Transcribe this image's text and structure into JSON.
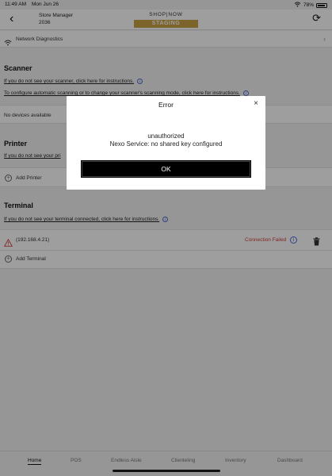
{
  "status_bar": {
    "time": "11:49 AM",
    "date": "Mon Jun 26",
    "battery": "78%"
  },
  "header": {
    "store_line1": "Store Manager",
    "store_line2": "2036",
    "logo": "SHOP|NOW",
    "env_badge": "STAGING"
  },
  "network": {
    "label": "Network Diagnostics"
  },
  "scanner": {
    "title": "Scanner",
    "link1": "If you do not see your scanner, click here for instructions.",
    "link2": "To configure automatic scanning or to change your scanner's scanning mode, click here for instructions.",
    "empty": "No devices available"
  },
  "printer": {
    "title": "Printer",
    "link1": "If you do not see your pri",
    "add": "Add Printer"
  },
  "terminal": {
    "title": "Terminal",
    "link1": "If you do not see your terminal connected, click here for instructions.",
    "device_ip": "(192.168.4.21)",
    "device_status": "Connection Failed",
    "add": "Add Terminal"
  },
  "tabs": [
    {
      "label": "Home"
    },
    {
      "label": "POS"
    },
    {
      "label": "Endless Aisle"
    },
    {
      "label": "Clienteling"
    },
    {
      "label": "Inventory"
    },
    {
      "label": "Dashboard"
    }
  ],
  "dialog": {
    "title": "Error",
    "message_line1": "unauthorized",
    "message_line2": "Nexo Service: no shared key configured",
    "ok_label": "OK"
  },
  "colors": {
    "accent": "#c9a246",
    "error": "#d23c3c",
    "info": "#4a6bd6"
  }
}
